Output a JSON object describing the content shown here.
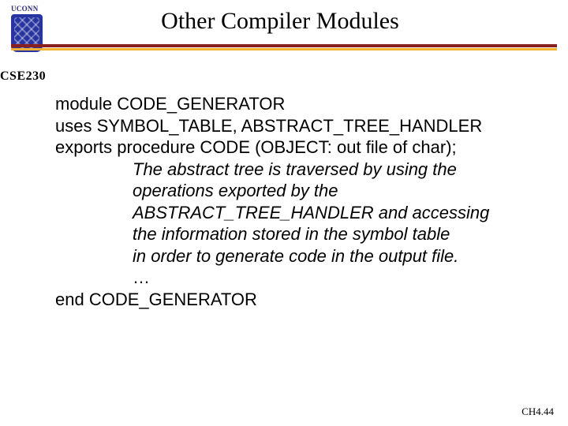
{
  "header": {
    "title": "Other Compiler Modules",
    "logo_text": "UCONN"
  },
  "course_label": "CSE230",
  "body": {
    "line1": "module CODE_GENERATOR",
    "line2": "uses SYMBOL_TABLE, ABSTRACT_TREE_HANDLER",
    "line3": "exports procedure CODE (OBJECT: out file of char);",
    "desc1": "The abstract tree is traversed by using the",
    "desc2": "operations exported by the",
    "desc3": "ABSTRACT_TREE_HANDLER and accessing",
    "desc4": "the information stored in the symbol table",
    "desc5": "in order to generate code in the output file.",
    "ellipsis": "…",
    "line_end": "end CODE_GENERATOR"
  },
  "footer": "CH4.44"
}
